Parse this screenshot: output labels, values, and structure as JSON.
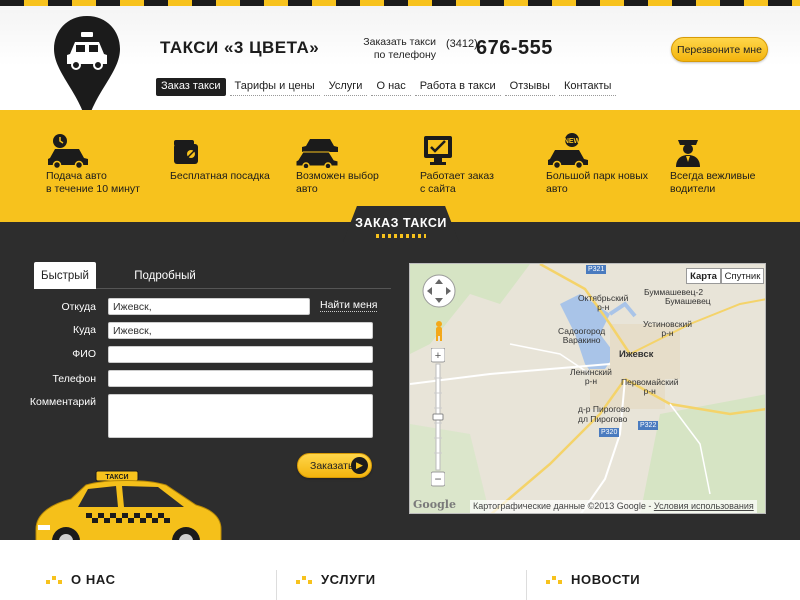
{
  "header": {
    "brand": "ТАКСИ «3 ЦВЕТА»",
    "phone_caption_line1": "Заказать такси",
    "phone_caption_line2": "по телефону",
    "phone_code": "(3412)",
    "phone_number": "676-555",
    "callback_label": "Перезвоните мне"
  },
  "nav": [
    {
      "label": "Заказ такси",
      "active": true
    },
    {
      "label": "Тарифы и цены"
    },
    {
      "label": "Услуги"
    },
    {
      "label": "О нас"
    },
    {
      "label": "Работа в такси"
    },
    {
      "label": "Отзывы"
    },
    {
      "label": "Контакты"
    }
  ],
  "features": [
    {
      "icon": "taxi-clock-icon",
      "line1": "Подача авто",
      "line2": "в течение 10 минут"
    },
    {
      "icon": "wallet-icon",
      "line1": "Бесплатная посадка",
      "line2": ""
    },
    {
      "icon": "two-cars-icon",
      "line1": "Возможен выбор",
      "line2": "авто"
    },
    {
      "icon": "computer-check-icon",
      "line1": "Работает заказ",
      "line2": "с сайта"
    },
    {
      "icon": "cars-fleet-icon",
      "line1": "Большой парк новых",
      "line2": "авто"
    },
    {
      "icon": "driver-icon",
      "line1": "Всегда вежливые",
      "line2": "водители"
    }
  ],
  "order": {
    "title": "ЗАКАЗ ТАКСИ",
    "tab_quick": "Быстрый",
    "tab_detailed": "Подробный",
    "from_label": "Откуда",
    "from_value": "Ижевск,",
    "find_me": "Найти меня",
    "to_label": "Куда",
    "to_value": "Ижевск,",
    "name_label": "ФИО",
    "phone_label": "Телефон",
    "comment_label": "Комментарий",
    "submit_label": "Заказать"
  },
  "map": {
    "type_map": "Карта",
    "type_satellite": "Спутник",
    "labels": {
      "buma": "Буммашевец-2",
      "buma2": "Бумашевец",
      "okt": "Октябрьский",
      "rn": "р-н",
      "ust": "Устиновский",
      "sad": "Садоогород",
      "vark": "Варакино",
      "izh": "Ижевск",
      "len": "Ленинский",
      "perv": "Первомайский",
      "pir": "д-р Пирогово",
      "dpir": "дл Пирогово"
    },
    "roads": {
      "p321": "Р321",
      "p320": "Р320",
      "p322": "Р322"
    },
    "copyright": "Картографические данные ©2013 Google - ",
    "terms": "Условия использования",
    "google": "Google"
  },
  "footer": {
    "about": "О НАС",
    "services": "УСЛУГИ",
    "news": "НОВОСТИ"
  },
  "colors": {
    "accent": "#f7c21d",
    "dark": "#2d2d2d",
    "text": "#1c1c1c"
  }
}
